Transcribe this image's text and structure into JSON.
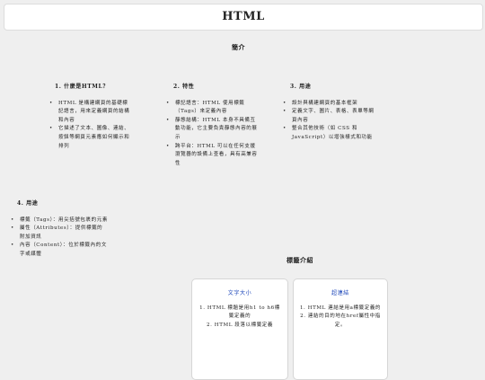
{
  "header": {
    "title": "HTML"
  },
  "intro": {
    "title": "簡介",
    "sections": [
      {
        "heading": "1. 什麼是HTML？",
        "items": [
          "HTML 是構建網頁的基礎標記語言，用來定義網頁的結構和內容",
          "它描述了文本、圖像、連結、按鈕等網頁元素應如何顯示和排列"
        ]
      },
      {
        "heading": "2. 特性",
        "items": [
          "標記語言：HTML 使用標籤（Tags）來定義內容",
          "靜態結構：HTML 本身不具備互動功能，它主要負責靜態內容的展示",
          "跨平台：HTML 可以在任何支援瀏覽器的設備上查看，具有高兼容性"
        ]
      },
      {
        "heading": "3. 用途",
        "items": [
          "設計與構建網頁的基本框架",
          "定義文字、圖片、表格、表單等網頁內容",
          "整合其他技術（如 CSS 和 JavaScript）以增強樣式和功能"
        ]
      },
      {
        "heading": "4. 用途",
        "items": [
          "標籤（Tags）：用尖括號包裹的元素",
          "屬性（Attributes）：提供標籤的附加資訊",
          "內容（Content）：位於標籤內的文字或媒體"
        ]
      }
    ]
  },
  "tags": {
    "title": "標籤介紹",
    "cards": [
      {
        "title": "文字大小",
        "items": [
          "1. HTML 標題是用h1 to h6標籤定義的",
          "2. HTML 段落以標籤定義"
        ]
      },
      {
        "title": "超連結",
        "items": [
          "1. HTML 連結是用a標籤定義的",
          "2. 連結的目的地在href屬性中指定。"
        ]
      }
    ]
  }
}
